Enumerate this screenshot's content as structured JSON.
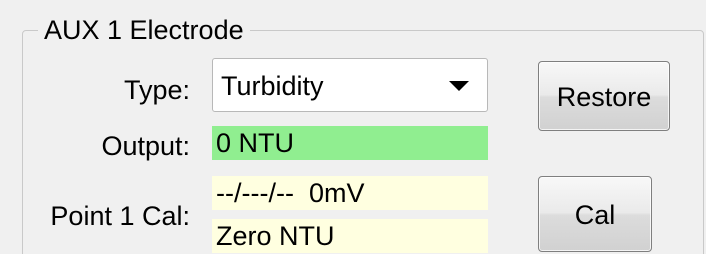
{
  "group": {
    "title": "AUX 1 Electrode"
  },
  "type": {
    "label": "Type:",
    "selected": "Turbidity"
  },
  "output": {
    "label": "Output:",
    "value": "0 NTU"
  },
  "calibration": {
    "label": "Point 1 Cal:",
    "line1": "--/---/--  0mV",
    "line2": "Zero NTU"
  },
  "buttons": {
    "restore": "Restore",
    "cal": "Cal"
  },
  "colors": {
    "output_background": "#90EE90",
    "calibration_background": "#FFFFE0",
    "window_background": "#F0F0F0"
  }
}
